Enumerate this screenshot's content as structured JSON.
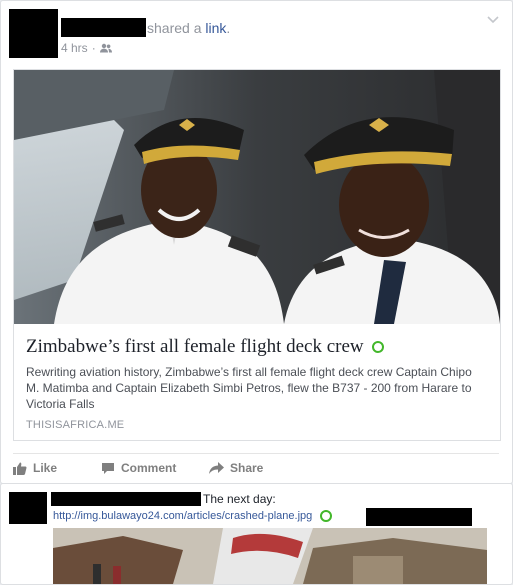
{
  "post": {
    "action_text": "shared a ",
    "action_link": "link",
    "action_end": ".",
    "timestamp": "4 hrs",
    "separator": "·",
    "audience_icon": "friends-icon",
    "menu_icon": "chevron-down-icon"
  },
  "link_card": {
    "title": "Zimbabwe’s first all female flight deck crew",
    "description": "Rewriting aviation history, Zimbabwe’s first all female flight deck crew Captain Chipo M. Matimba and Captain Elizabeth Simbi Petros, flew the B737 - 200 from Harare to Victoria Falls",
    "source": "THISISAFRICA.ME"
  },
  "actions": {
    "like": "Like",
    "comment": "Comment",
    "share": "Share"
  },
  "comment": {
    "text": "The next day:",
    "link": "http://img.bulawayo24.com/articles/crashed-plane.jpg"
  },
  "colors": {
    "link": "#365899",
    "meta": "#90949c",
    "verified_green": "#42b72a",
    "action": "#7f7f7f"
  }
}
